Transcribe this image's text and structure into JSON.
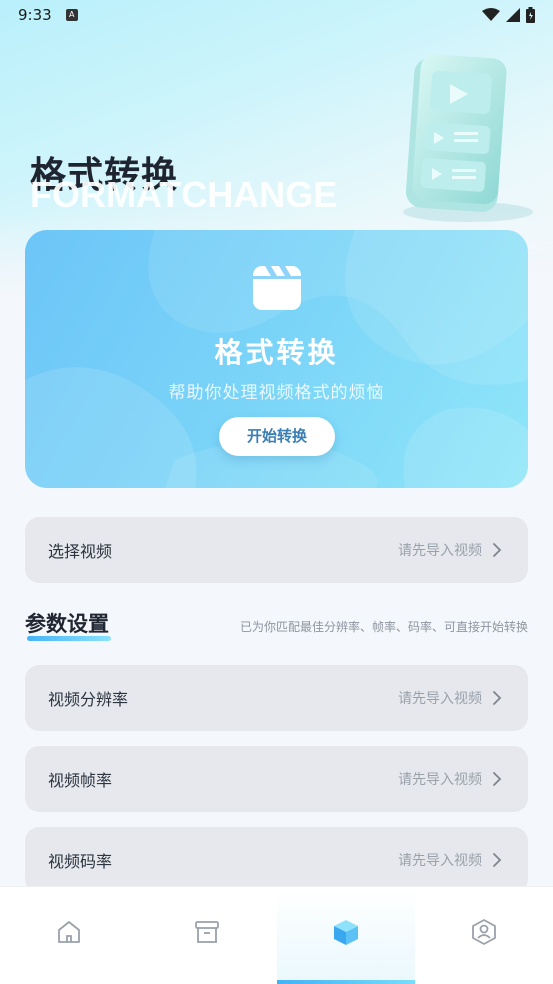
{
  "status_bar": {
    "time": "9:33",
    "notification_letter": "A"
  },
  "hero": {
    "title": "格式转换",
    "subtitle": "FORMATCHANGE"
  },
  "banner": {
    "title": "格式转换",
    "description": "帮助你处理视频格式的烦恼",
    "button_label": "开始转换"
  },
  "select_video": {
    "label": "选择视频",
    "value": "请先导入视频"
  },
  "params": {
    "title": "参数设置",
    "hint": "已为你匹配最佳分辨率、帧率、码率、可直接开始转换",
    "rows": [
      {
        "label": "视频分辨率",
        "value": "请先导入视频"
      },
      {
        "label": "视频帧率",
        "value": "请先导入视频"
      },
      {
        "label": "视频码率",
        "value": "请先导入视频"
      }
    ]
  },
  "bottom_nav": {
    "items": [
      {
        "icon": "home-icon",
        "active": false
      },
      {
        "icon": "archive-box-icon",
        "active": false
      },
      {
        "icon": "cube-icon",
        "active": true
      },
      {
        "icon": "user-badge-icon",
        "active": false
      }
    ]
  },
  "colors": {
    "accent": "#47b4f5",
    "banner_start": "#6cc5f7",
    "banner_end": "#8fe6f9",
    "row_bg": "#e6e8ed"
  }
}
